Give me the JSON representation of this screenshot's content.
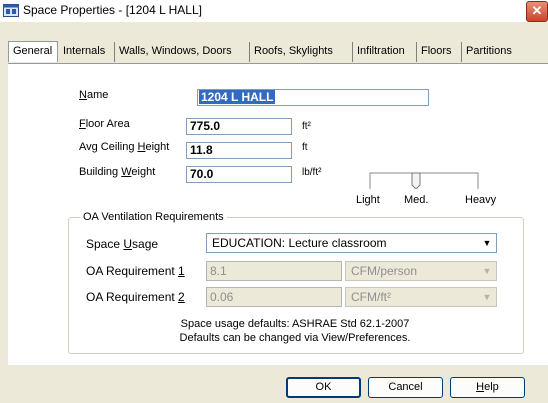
{
  "window": {
    "title": "Space Properties - [1204 L HALL]",
    "close_glyph": "✕",
    "accent": "#316ac5"
  },
  "tabs": [
    {
      "label": "General",
      "active": true
    },
    {
      "label": "Internals"
    },
    {
      "label": "Walls, Windows, Doors"
    },
    {
      "label": "Roofs, Skylights"
    },
    {
      "label": "Infiltration"
    },
    {
      "label": "Floors"
    },
    {
      "label": "Partitions"
    }
  ],
  "general": {
    "name": {
      "label": "Name",
      "value": "1204 L HALL"
    },
    "floor_area": {
      "label": "Floor Area",
      "value": "775.0",
      "unit": "ft²"
    },
    "avg_ceiling_height": {
      "label": "Avg Ceiling Height",
      "value": "11.8",
      "unit": "ft"
    },
    "building_weight": {
      "label": "Building Weight",
      "value": "70.0",
      "unit": "lb/ft²"
    },
    "slider": {
      "level": 0.42,
      "labels": [
        "Light",
        "Med.",
        "Heavy"
      ]
    }
  },
  "oa": {
    "group_title": "OA Ventilation Requirements",
    "space_usage": {
      "label": "Space Usage",
      "value": "EDUCATION: Lecture classroom"
    },
    "req1": {
      "label": "OA Requirement 1",
      "value": "8.1",
      "unit": "CFM/person"
    },
    "req2": {
      "label": "OA Requirement 2",
      "value": "0.06",
      "unit": "CFM/ft²"
    },
    "note_line1": "Space usage defaults: ASHRAE Std 62.1-2007",
    "note_line2": "Defaults can be changed via View/Preferences."
  },
  "buttons": {
    "ok": "OK",
    "cancel": "Cancel",
    "help": "Help"
  },
  "icons": {
    "title": "application-window-icon",
    "close": "close-icon",
    "dropdown": "chevron-down-icon",
    "slider": "slider-thumb"
  }
}
